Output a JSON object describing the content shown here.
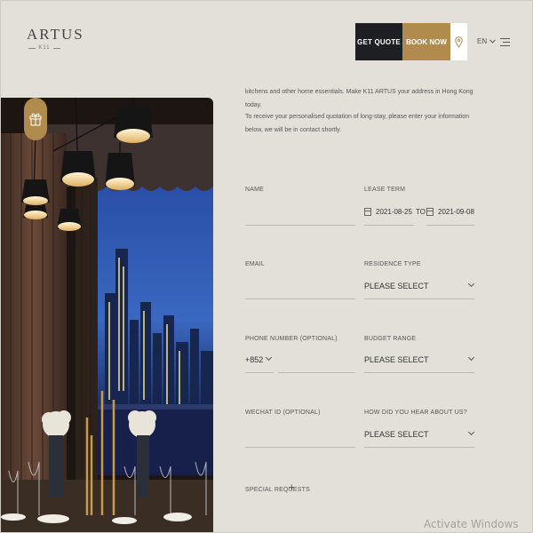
{
  "brand": {
    "name": "ARTUS",
    "sub": "K11"
  },
  "header": {
    "quote_label": "GET QUOTE",
    "book_label": "BOOK NOW",
    "lang": "EN"
  },
  "intro": {
    "line1": "kitchens and other home essentials. Make K11 ARTUS your address in Hong Kong today.",
    "line2": "To receive your personalised quotation of long-stay, please enter your information below, we will be in contact shortly."
  },
  "form": {
    "name_label": "NAME",
    "lease_label": "LEASE TERM",
    "lease_from": "2021-08-25",
    "lease_to_word": "TO",
    "lease_to": "2021-09-08",
    "email_label": "EMAIL",
    "residence_label": "RESIDENCE TYPE",
    "residence_value": "PLEASE SELECT",
    "phone_label": "PHONE NUMBER (OPTIONAL)",
    "phone_code": "+852",
    "budget_label": "BUDGET RANGE",
    "budget_value": "PLEASE SELECT",
    "wechat_label": "WECHAT ID (OPTIONAL)",
    "hear_label": "HOW DID YOU HEAR ABOUT US?",
    "hear_value": "PLEASE SELECT",
    "special_label": "SPECIAL REQUESTS"
  },
  "watermark": "Activate Windows",
  "colors": {
    "accent": "#b18b4d",
    "dark": "#1e1f22",
    "background": "#e3e0da"
  }
}
